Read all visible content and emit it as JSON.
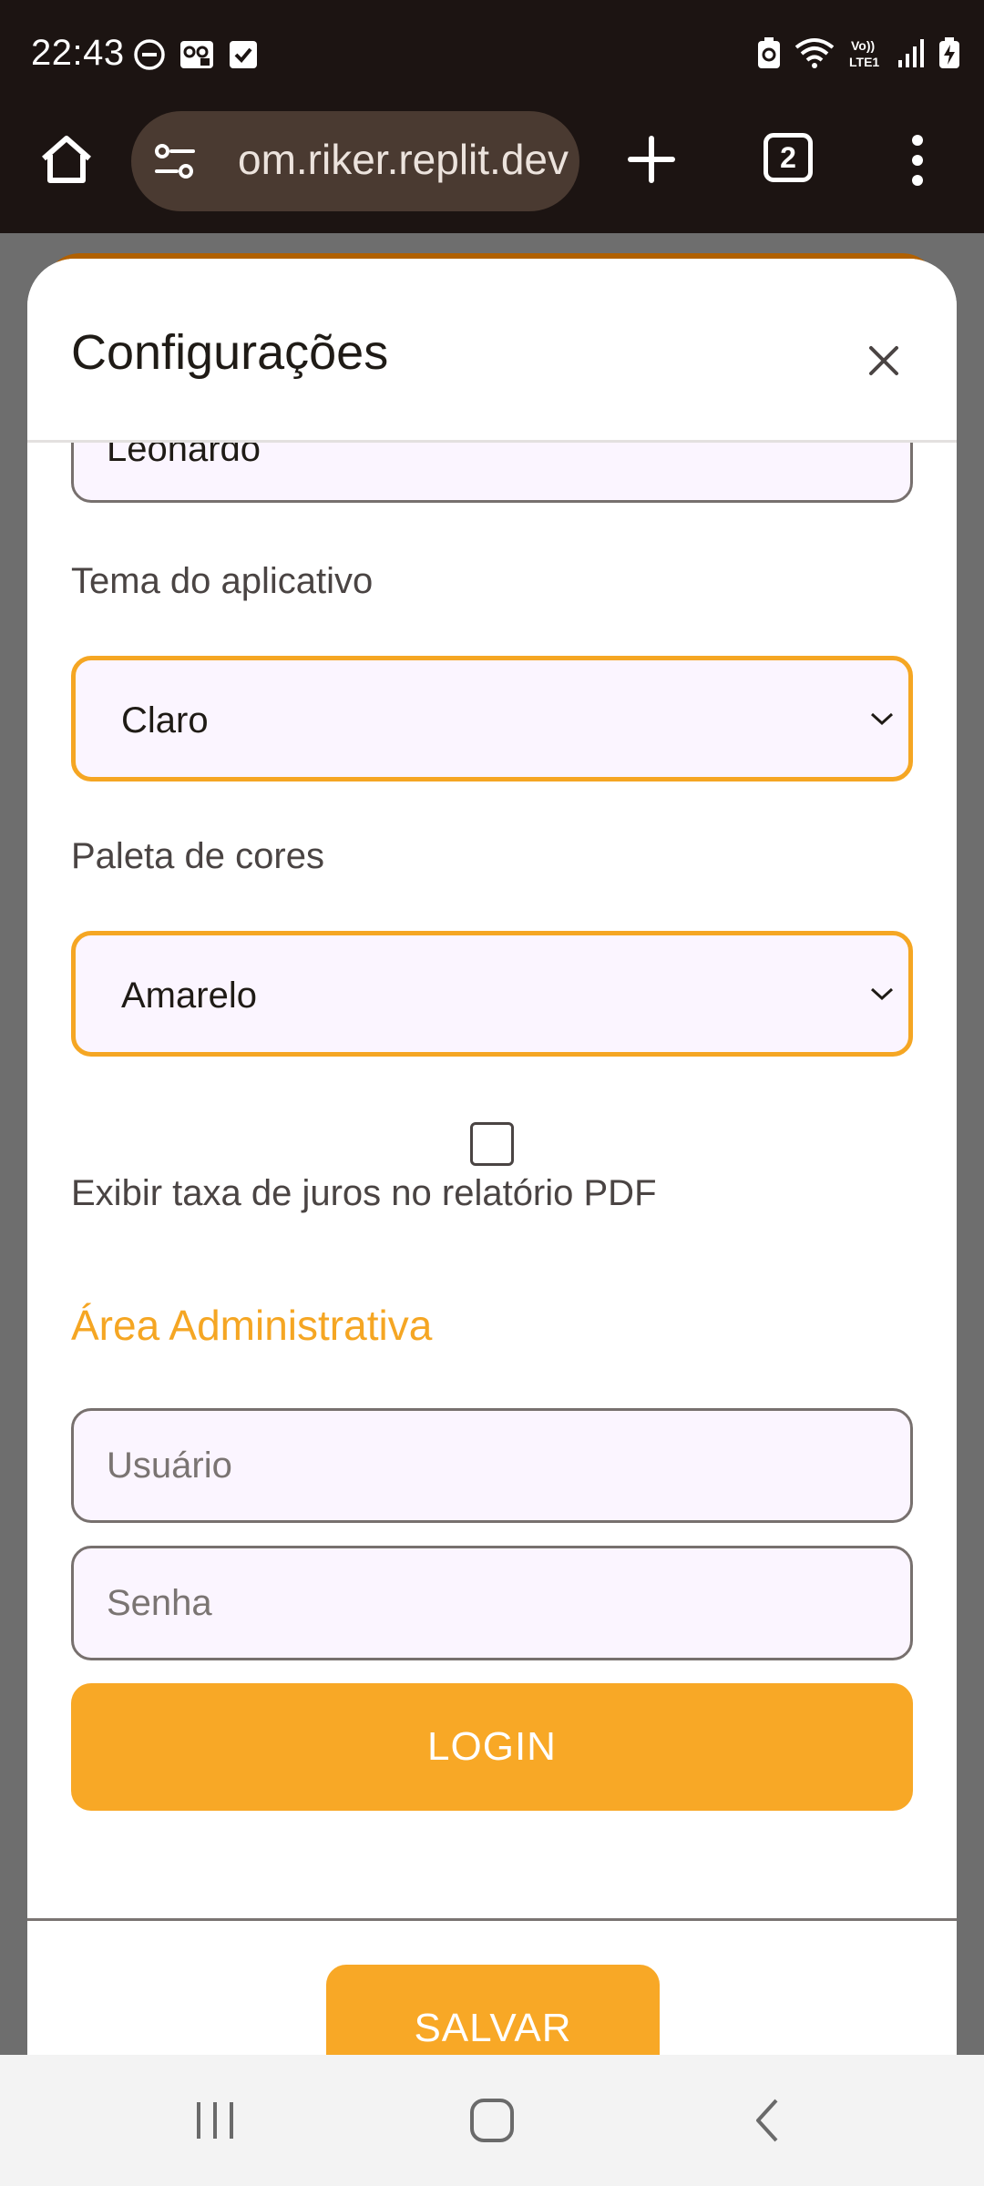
{
  "status_bar": {
    "time": "22:43",
    "left_icons": [
      "do-not-disturb-icon",
      "voicemail-icon",
      "checkbox-notification-icon"
    ],
    "right_icons": [
      "battery-saver-icon",
      "wifi-icon",
      "volte-icon",
      "signal-icon",
      "battery-charging-icon"
    ]
  },
  "browser": {
    "url": "om.riker.replit.dev",
    "tab_count": "2",
    "icons": [
      "home-icon",
      "site-info-icon",
      "plus-icon",
      "tabs-icon",
      "more-vert-icon"
    ]
  },
  "modal": {
    "title": "Configurações",
    "name_value": "Leonardo",
    "theme_label": "Tema do aplicativo",
    "theme_value": "Claro",
    "palette_label": "Paleta de cores",
    "palette_value": "Amarelo",
    "interest_checkbox_label": "Exibir taxa de juros no relatório PDF",
    "interest_checkbox_checked": false,
    "admin_title": "Área Administrativa",
    "user_placeholder": "Usuário",
    "password_placeholder": "Senha",
    "login_label": "LOGIN",
    "save_label": "SALVAR"
  },
  "colors": {
    "accent": "#f8a826",
    "browser_bg": "#1c1412",
    "field_bg": "#fbf5ff"
  },
  "nav_bar": {
    "icons": [
      "recent-apps-icon",
      "home-nav-icon",
      "back-icon"
    ]
  }
}
